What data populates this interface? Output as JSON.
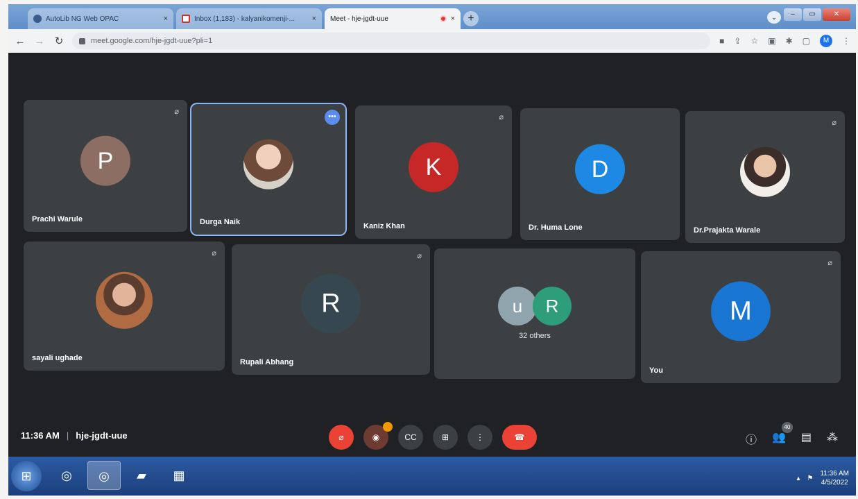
{
  "browser": {
    "tabs": [
      {
        "title": "AutoLib NG Web OPAC",
        "favicon": "autolib-icon",
        "active": false
      },
      {
        "title": "Inbox (1,183) - kalyanikomenji-...",
        "favicon": "gmail-icon",
        "active": false
      },
      {
        "title": "Meet - hje-jgdt-uue",
        "favicon": "meet-icon",
        "active": true
      }
    ],
    "close_glyph": "×",
    "new_tab_glyph": "+",
    "url": "meet.google.com/hje-jgdt-uue?pli=1",
    "profile_initial": "M"
  },
  "meet": {
    "participants": [
      {
        "name": "Prachi Warule",
        "initial": "P",
        "avatar_color": "#8d6e63",
        "type": "initial",
        "muted": true
      },
      {
        "name": "Durga Naik",
        "initial": "",
        "avatar_color": "",
        "type": "photo",
        "muted": false,
        "pinned": true
      },
      {
        "name": "Kaniz Khan",
        "initial": "K",
        "avatar_color": "#c62828",
        "type": "initial",
        "muted": true
      },
      {
        "name": "Dr. Huma Lone",
        "initial": "D",
        "avatar_color": "#1e88e5",
        "type": "initial",
        "muted": false
      },
      {
        "name": "Dr.Prajakta Warale",
        "initial": "",
        "avatar_color": "",
        "type": "photo",
        "muted": true
      },
      {
        "name": "sayali ughade",
        "initial": "",
        "avatar_color": "",
        "type": "photo",
        "muted": true
      },
      {
        "name": "Rupali Abhang",
        "initial": "R",
        "avatar_color": "#37474f",
        "type": "initial",
        "muted": true
      },
      {
        "name": "You",
        "initial": "M",
        "avatar_color": "#1976d2",
        "type": "initial",
        "muted": true
      }
    ],
    "others": {
      "label": "32 others",
      "avatars": [
        {
          "initial": "u",
          "color": "#90a4ae"
        },
        {
          "initial": "R",
          "color": "#2e9e7a"
        }
      ]
    },
    "time": "11:36 AM",
    "meeting_code": "hje-jgdt-uue",
    "people_count": "40"
  },
  "taskbar": {
    "time": "11:36 AM",
    "date": "4/5/2022"
  }
}
